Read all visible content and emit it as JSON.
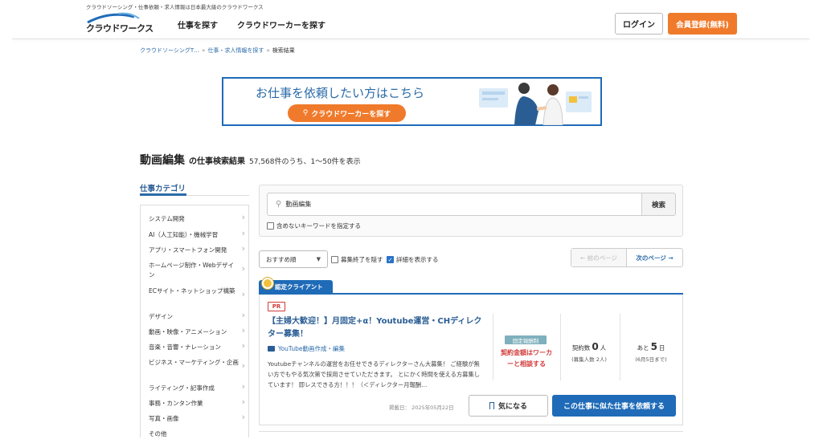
{
  "header": {
    "tagline": "クラウドソーシング・仕事依頼・求人情報は日本最大級のクラウドワークス",
    "logo_text": "クラウドワークス",
    "nav": [
      "仕事を探す",
      "クラウドワーカーを探す"
    ],
    "login_label": "ログイン",
    "register_label": "会員登録(無料)"
  },
  "breadcrumb": [
    "クラウドソーシングT…",
    "仕事・求人情報を探す",
    "検索結果"
  ],
  "banner": {
    "title": "お仕事を依頼したい方はこちら",
    "button_label": "クラウドワーカーを探す"
  },
  "results": {
    "keyword": "動画編集",
    "suffix": "の仕事検索結果",
    "count_text": "57,568件のうち、1〜50件を表示"
  },
  "sidebar": {
    "title": "仕事カテゴリ",
    "categories": [
      "システム開発",
      "AI（人工知能）・機械学習",
      "アプリ・スマートフォン開発",
      "ホームページ制作・Webデザイン",
      "ECサイト・ネットショップ構築",
      "デザイン",
      "動画・映像・アニメーション",
      "音楽・音響・ナレーション",
      "ビジネス・マーケティング・企画",
      "ライティング・記事作成",
      "事務・カンタン作業",
      "写真・画像",
      "その他"
    ]
  },
  "search": {
    "value": "動画編集",
    "button_label": "検索",
    "exclude_label": "含めないキーワードを指定する"
  },
  "controls": {
    "sort_value": "おすすめ順",
    "hide_closed_label": "募集終了を隠す",
    "show_detail_label": "詳細を表示する",
    "prev_label": "← 前のページ",
    "next_label": "次のページ →"
  },
  "job": {
    "client_tab": "認定クライアント",
    "pr_label": "PR",
    "title": "【主婦大歓迎！】月固定+α！Youtube運営・CHディレクター募集！",
    "category": "YouTube動画作成・編集",
    "description": "Youtubeチャンネルの運営をお任せできるディレクターさん大募集！ ご経験が無い方でもやる気次第で採用させていただきます。 とにかく時間を使える方募集しています！ 即レスできる方！！！（＜ディレクター月報酬…",
    "fixed_badge": "固定報酬制",
    "price_text": "契約金額はワーカーと相談する",
    "contract_label": "契約数",
    "contract_count": "0",
    "contract_unit": "人",
    "contract_sub": "(募集人数 2人)",
    "remain_prefix": "あと",
    "remain_days": "5",
    "remain_unit": "日",
    "remain_sub": "(6月5日まで)",
    "posted": "掲載日： 2025年05月22日",
    "fav_label": "気になる",
    "request_label": "この仕事に似た仕事を依頼する"
  },
  "colors": {
    "brand_blue": "#1f6bb8",
    "accent_orange": "#f07a2b",
    "alert_red": "#d23a3a"
  }
}
